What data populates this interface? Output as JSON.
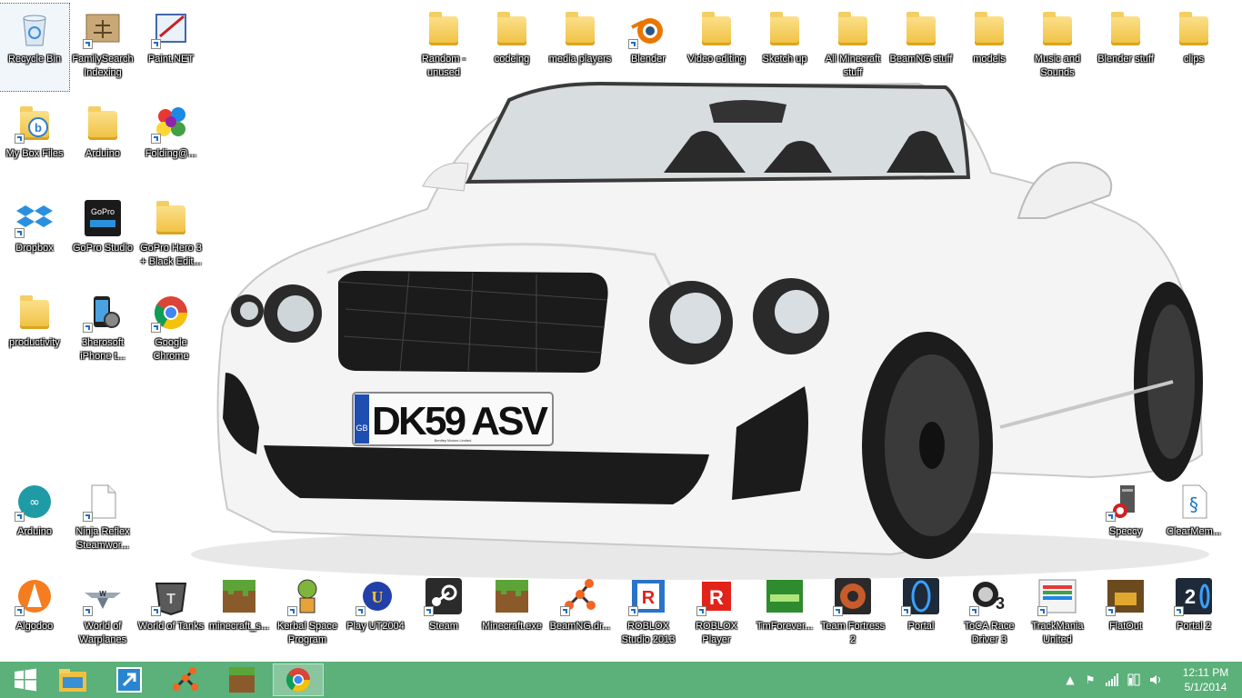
{
  "desktop": {
    "icons": [
      {
        "label": "Recycle Bin",
        "name": "recycle-bin-icon"
      },
      {
        "label": "FamilySearch Indexing",
        "name": "familysearch-indexing-icon"
      },
      {
        "label": "Paint.NET",
        "name": "paint-net-icon"
      },
      {
        "label": "My Box Files",
        "name": "box-files-icon"
      },
      {
        "label": "Arduino",
        "name": "folder-icon"
      },
      {
        "label": "Folding@...",
        "name": "folding-at-home-icon"
      },
      {
        "label": "Dropbox",
        "name": "dropbox-icon"
      },
      {
        "label": "GoPro Studio",
        "name": "gopro-studio-icon"
      },
      {
        "label": "GoPro Hero 3 + Black Edit...",
        "name": "folder-icon"
      },
      {
        "label": "productivity",
        "name": "folder-icon"
      },
      {
        "label": "3herosoft iPhone t...",
        "name": "iphone-transfer-icon"
      },
      {
        "label": "Google Chrome",
        "name": "chrome-icon"
      },
      {
        "label": "Arduino",
        "name": "arduino-icon"
      },
      {
        "label": "Ninja Reflex Steamwor...",
        "name": "file-icon"
      },
      {
        "label": "Random - unused",
        "name": "folder-icon"
      },
      {
        "label": "codeing",
        "name": "folder-icon"
      },
      {
        "label": "media players",
        "name": "folder-icon"
      },
      {
        "label": "Blender",
        "name": "blender-icon"
      },
      {
        "label": "Video editing",
        "name": "folder-icon"
      },
      {
        "label": "Sketch up",
        "name": "folder-icon"
      },
      {
        "label": "All Minecraft stuff",
        "name": "folder-icon"
      },
      {
        "label": "BeamNG stuff",
        "name": "folder-icon"
      },
      {
        "label": "models",
        "name": "folder-icon"
      },
      {
        "label": "Music and Sounds",
        "name": "folder-icon"
      },
      {
        "label": "Blender stuff",
        "name": "folder-icon"
      },
      {
        "label": "clips",
        "name": "folder-icon"
      },
      {
        "label": "Speccy",
        "name": "speccy-icon"
      },
      {
        "label": "ClearMem...",
        "name": "clearmem-icon"
      },
      {
        "label": "Algodoo",
        "name": "algodoo-icon"
      },
      {
        "label": "World of Warplanes",
        "name": "world-of-warplanes-icon"
      },
      {
        "label": "World of Tanks",
        "name": "world-of-tanks-icon"
      },
      {
        "label": "minecraft_s...",
        "name": "minecraft-icon"
      },
      {
        "label": "Kerbal Space Program",
        "name": "kerbal-space-program-icon"
      },
      {
        "label": "Play UT2004",
        "name": "unreal-tournament-icon"
      },
      {
        "label": "Steam",
        "name": "steam-icon"
      },
      {
        "label": "Minecraft.exe",
        "name": "minecraft-icon"
      },
      {
        "label": "BeamNG.dr...",
        "name": "beamng-icon"
      },
      {
        "label": "ROBLOX Studio 2013",
        "name": "roblox-studio-icon"
      },
      {
        "label": "ROBLOX Player",
        "name": "roblox-player-icon"
      },
      {
        "label": "TmForever...",
        "name": "tmforever-icon"
      },
      {
        "label": "Team Fortress 2",
        "name": "team-fortress-2-icon"
      },
      {
        "label": "Portal",
        "name": "portal-icon"
      },
      {
        "label": "ToCA Race Driver 3",
        "name": "toca-race-driver-icon"
      },
      {
        "label": "TrackMania United",
        "name": "trackmania-icon"
      },
      {
        "label": "FlatOut",
        "name": "flatout-icon"
      },
      {
        "label": "Portal 2",
        "name": "portal-2-icon"
      }
    ],
    "plate": {
      "country": "GB",
      "text": "DK59 ASV",
      "dealer": "Bentley Motors Limited"
    }
  },
  "taskbar": {
    "color": "#5cb07a",
    "buttons": [
      {
        "name": "start-button",
        "icon": "windows-logo-icon"
      },
      {
        "name": "file-explorer-button",
        "icon": "file-explorer-icon"
      },
      {
        "name": "remote-desktop-button",
        "icon": "remote-desktop-icon"
      },
      {
        "name": "beamng-taskbar-button",
        "icon": "beamng-icon"
      },
      {
        "name": "minecraft-taskbar-button",
        "icon": "minecraft-icon"
      },
      {
        "name": "chrome-taskbar-button",
        "icon": "chrome-icon"
      }
    ],
    "clock": {
      "time": "12:11 PM",
      "date": "5/1/2014"
    }
  }
}
